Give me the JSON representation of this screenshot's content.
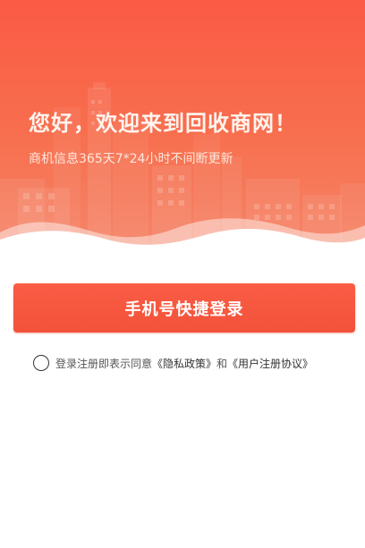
{
  "header": {
    "title": "您好，欢迎来到回收商网！",
    "subtitle": "商机信息365天7*24小时不间断更新"
  },
  "login": {
    "button_label": "手机号快捷登录"
  },
  "agreement": {
    "prefix": "登录注册即表示同意",
    "privacy_link": "《隐私政策》",
    "conjunction": "和",
    "terms_link": "《用户注册协议》",
    "checked": false
  },
  "colors": {
    "brand": "#f5533d",
    "hero_top": "#fb5a44",
    "hero_bottom": "#f5866a",
    "button": "#f5533d"
  }
}
